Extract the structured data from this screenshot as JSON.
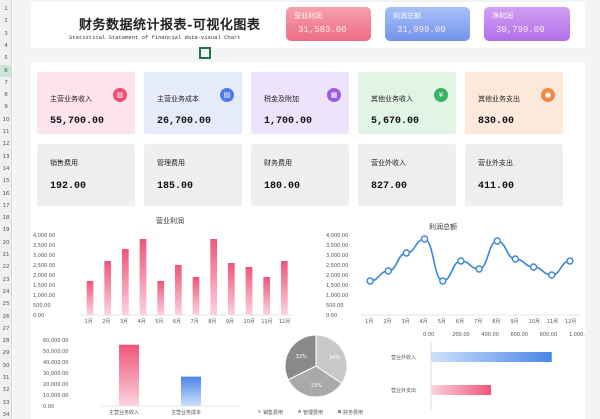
{
  "row_numbers": [
    "1",
    "2",
    "3",
    "4",
    "5",
    "6",
    "7",
    "8",
    "9",
    "10",
    "11",
    "12",
    "13",
    "14",
    "15",
    "16",
    "17",
    "18",
    "19",
    "20",
    "21",
    "22",
    "23",
    "24",
    "25",
    "26",
    "27",
    "28",
    "29",
    "30",
    "31",
    "32",
    "33",
    "34"
  ],
  "selected_row": "6",
  "header": {
    "title": "财务数据统计报表-可视化图表",
    "subtitle": "Statistical Statement of financial data-visual Chart"
  },
  "kpis": [
    {
      "label": "营业利润",
      "value": "31,583.00"
    },
    {
      "label": "利润总额",
      "value": "31,999.00"
    },
    {
      "label": "净利润",
      "value": "30,799.00"
    }
  ],
  "cards_row1": [
    {
      "label": "主营业务收入",
      "value": "55,700.00",
      "icon": "bar-chart-icon",
      "glyph": "▥",
      "bg": "#fde4ea",
      "icon_color": "#ee4d74"
    },
    {
      "label": "主营业务成本",
      "value": "26,700.00",
      "icon": "document-icon",
      "glyph": "▤",
      "bg": "#e5ebfb",
      "icon_color": "#4f7be8"
    },
    {
      "label": "税金及附加",
      "value": "1,700.00",
      "icon": "receipt-icon",
      "glyph": "▦",
      "bg": "#ede3fa",
      "icon_color": "#9b5ee0"
    },
    {
      "label": "其他业务收入",
      "value": "5,670.00",
      "icon": "yen-icon",
      "glyph": "¥",
      "bg": "#e1f4e6",
      "icon_color": "#3bb365"
    },
    {
      "label": "其他业务支出",
      "value": "830.00",
      "icon": "user-icon",
      "glyph": "●",
      "bg": "#fde8dc",
      "icon_color": "#f08a45"
    }
  ],
  "cards_row2": [
    {
      "label": "销售费用",
      "value": "192.00"
    },
    {
      "label": "管理费用",
      "value": "185.00"
    },
    {
      "label": "财务费用",
      "value": "180.00"
    },
    {
      "label": "营业外收入",
      "value": "827.00"
    },
    {
      "label": "营业外支出",
      "value": "411.00"
    }
  ],
  "colors": {
    "pink": "#f0557a",
    "blue": "#4a86e8",
    "line": "#3a86d6"
  },
  "chart_data": [
    {
      "type": "bar",
      "title": "营业利润",
      "categories": [
        "1月",
        "2月",
        "3月",
        "4月",
        "5月",
        "6月",
        "7月",
        "8月",
        "9月",
        "10月",
        "11月",
        "12月"
      ],
      "values": [
        1700,
        2700,
        3300,
        3800,
        1700,
        2500,
        1900,
        3800,
        2600,
        2400,
        1900,
        2700
      ],
      "ylim": [
        0,
        4000
      ],
      "yticks": [
        "0.00",
        "500.00",
        "1,000.00",
        "1,500.00",
        "2,000.00",
        "2,500.00",
        "3,000.00",
        "3,500.00",
        "4,000.00"
      ]
    },
    {
      "type": "line",
      "title": "利润总额",
      "categories": [
        "1月",
        "2月",
        "3月",
        "4月",
        "5月",
        "6月",
        "7月",
        "8月",
        "9月",
        "10月",
        "11月",
        "12月"
      ],
      "values": [
        1700,
        2200,
        3100,
        3800,
        1700,
        2700,
        2300,
        3700,
        2800,
        2400,
        2000,
        2700
      ],
      "ylim": [
        0,
        4000
      ],
      "yticks": [
        "0.00",
        "500.00",
        "1,000.00",
        "1,500.00",
        "2,000.00",
        "2,500.00",
        "3,000.00",
        "3,500.00",
        "4,000.00"
      ]
    },
    {
      "type": "bar",
      "categories": [
        "主营业务收入",
        "主营业务成本"
      ],
      "values": [
        55700,
        26700
      ],
      "ylim": [
        0,
        60000
      ],
      "yticks": [
        "0.00",
        "10,000.00",
        "20,000.00",
        "30,000.00",
        "40,000.00",
        "50,000.00",
        "60,000.00"
      ]
    },
    {
      "type": "pie",
      "categories": [
        "销售费用",
        "管理费用",
        "财务费用"
      ],
      "values": [
        192,
        185,
        180
      ],
      "data_labels": [
        "34%",
        "33%",
        "32%"
      ],
      "legend": "bottom"
    },
    {
      "type": "bar",
      "orientation": "horizontal",
      "categories": [
        "营业外收入",
        "营业外支出"
      ],
      "values": [
        827,
        411
      ],
      "xlim": [
        0,
        1000
      ],
      "xticks": [
        "0.00",
        "200.00",
        "400.00",
        "600.00",
        "800.00",
        "1,000.00"
      ]
    }
  ]
}
